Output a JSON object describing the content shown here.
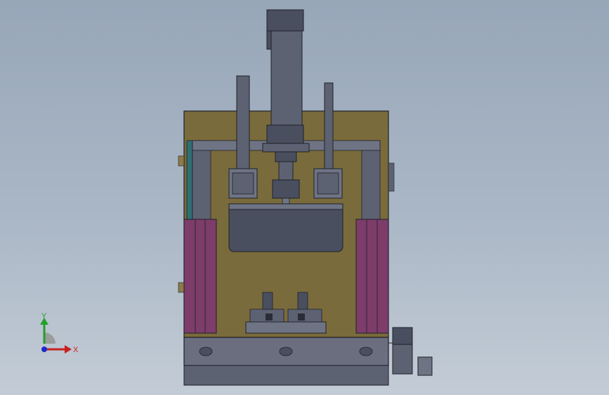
{
  "viewport": {
    "background_top": "#97a6b8",
    "background_bottom": "#c3ccd6"
  },
  "colors": {
    "frame_olive": "#7a6b3c",
    "steel_dark": "#4a4f5f",
    "steel_mid": "#5d6272",
    "steel_light": "#6f7485",
    "plate_gray": "#6a6e7e",
    "magenta_rail": "#7d3c6a",
    "teal_strip": "#2f6f72",
    "outline": "#1e2028"
  },
  "triad": {
    "y_label": "Y",
    "x_label": "X",
    "y_color": "#22a02a",
    "x_color": "#c82020",
    "z_color": "#1a2ad0"
  }
}
